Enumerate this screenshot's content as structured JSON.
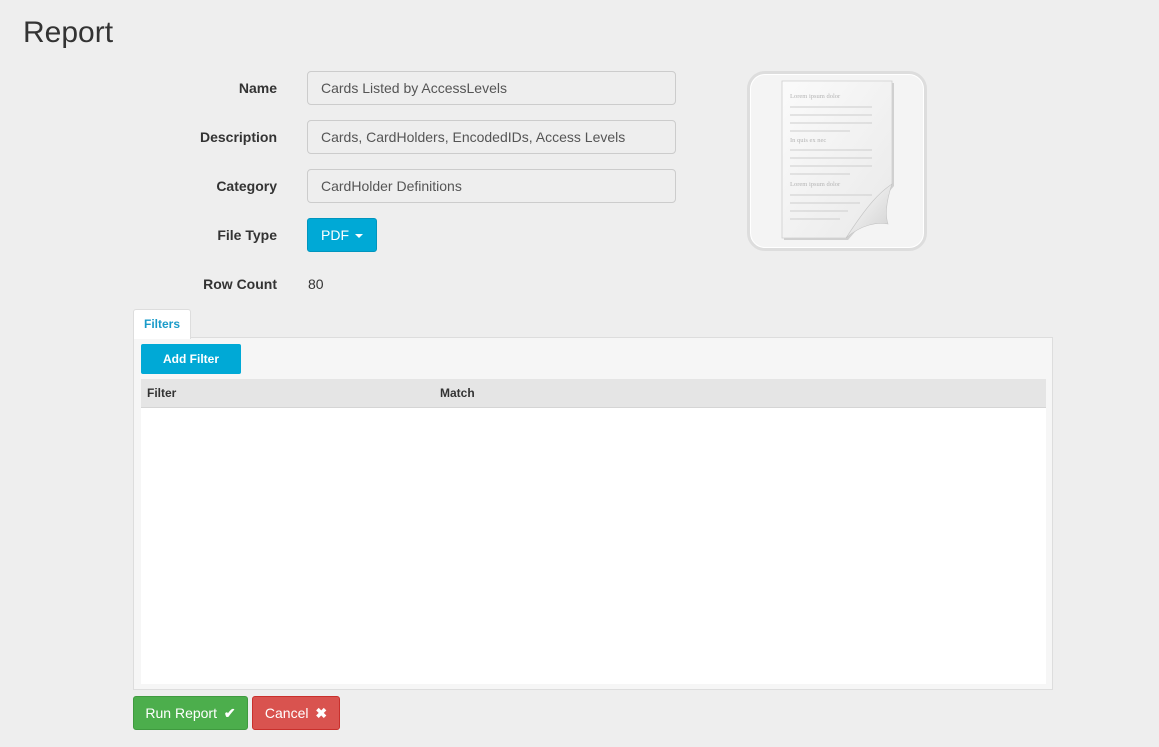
{
  "page": {
    "title": "Report"
  },
  "form": {
    "name_label": "Name",
    "name_value": "Cards Listed by AccessLevels",
    "description_label": "Description",
    "description_value": "Cards, CardHolders, EncodedIDs, Access Levels",
    "category_label": "Category",
    "category_value": "CardHolder Definitions",
    "file_type_label": "File Type",
    "file_type_value": "PDF",
    "row_count_label": "Row Count",
    "row_count_value": "80"
  },
  "preview": {
    "icon": "document-icon",
    "line1": "Lorem ipsum dolor",
    "line2": "In quis ex nec",
    "line3": "Lorem ipsum dolor"
  },
  "filters": {
    "tab_label": "Filters",
    "add_button": "Add Filter",
    "columns": [
      "Filter",
      "Match"
    ],
    "rows": []
  },
  "actions": {
    "run_label": "Run Report",
    "run_icon": "✔",
    "cancel_label": "Cancel",
    "cancel_icon": "✖"
  },
  "colors": {
    "accent": "#00a9d6",
    "success": "#4cae4c",
    "danger": "#d9534f"
  }
}
